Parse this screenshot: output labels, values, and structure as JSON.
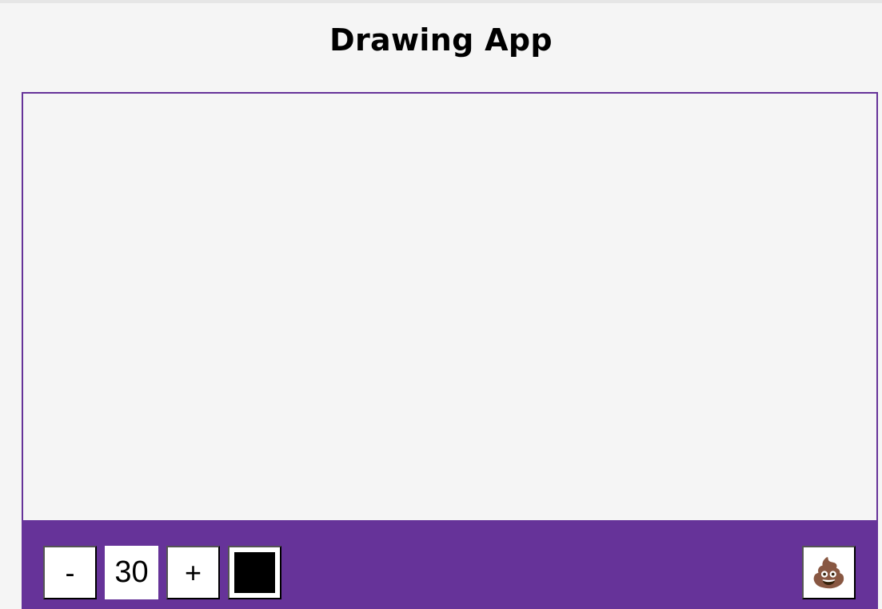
{
  "app": {
    "title": "Drawing App"
  },
  "toolbar": {
    "decrease_label": "-",
    "brush_size": "30",
    "increase_label": "+",
    "current_color": "#000000",
    "clear_icon": "pile-of-poo",
    "clear_glyph": "💩"
  },
  "colors": {
    "accent": "#663399",
    "background": "#f5f5f5",
    "button_bg": "#ffffff"
  }
}
